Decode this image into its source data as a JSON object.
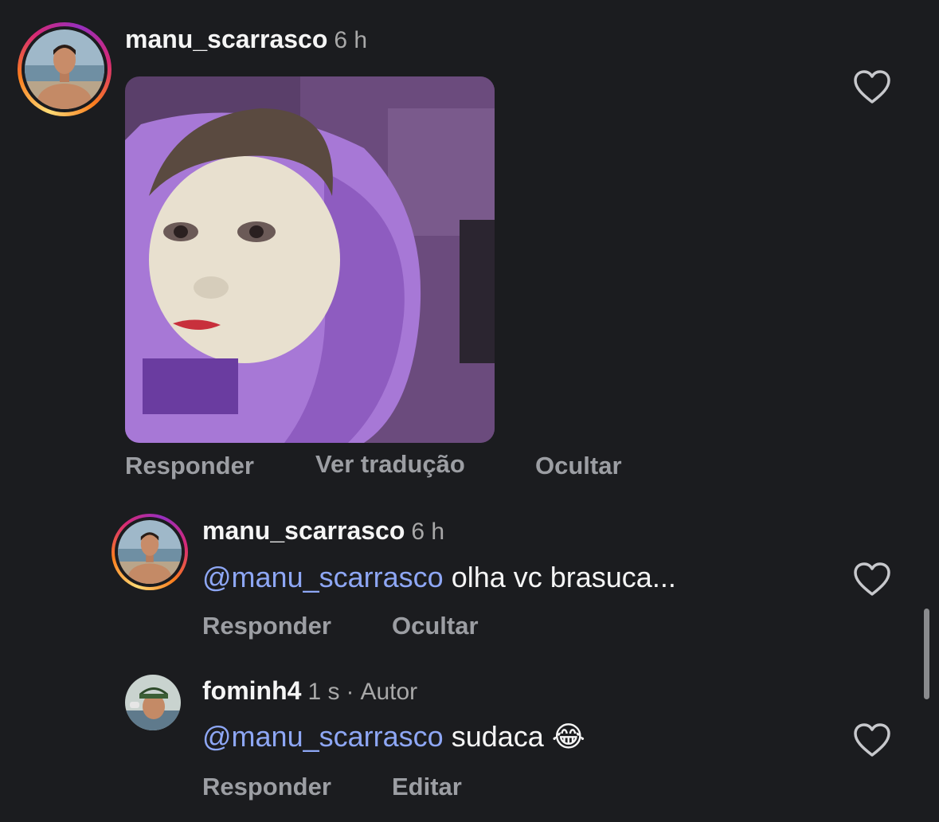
{
  "comments": [
    {
      "username": "manu_scarrasco",
      "time": "6 h",
      "actions": [
        "Responder",
        "Ver tradução",
        "Ocultar"
      ]
    },
    {
      "username": "manu_scarrasco",
      "time": "6 h",
      "mention": "@manu_scarrasco",
      "text": "olha vc brasuca...",
      "actions": [
        "Responder",
        "Ocultar"
      ]
    },
    {
      "username": "fominh4",
      "time": "1 s",
      "separator": "·",
      "badge": "Autor",
      "mention": "@manu_scarrasco",
      "text": "sudaca",
      "emoji": "😂",
      "actions": [
        "Responder",
        "Editar"
      ]
    }
  ],
  "icons": {
    "like": "heart-icon"
  },
  "colors": {
    "background": "#1b1c1f",
    "mention": "#8ea7f5",
    "action": "#9c9ea3",
    "meta": "#a8a8a8"
  }
}
